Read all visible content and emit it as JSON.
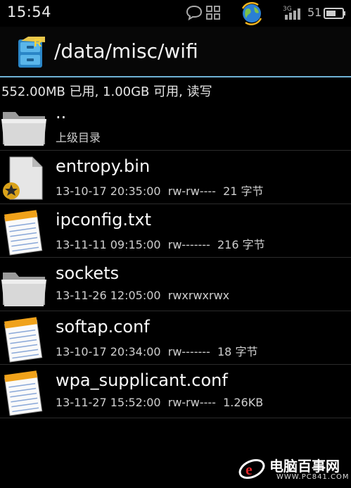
{
  "status_bar": {
    "time": "15:54",
    "icons": [
      "chat-bubble-icon",
      "grid-icon",
      "globe-sync-icon",
      "signal-3g-icon",
      "battery-icon"
    ],
    "network": "3G",
    "battery": "51"
  },
  "header": {
    "app_icon": "file-cabinet-icon",
    "path": "/data/misc/wifi"
  },
  "storage": {
    "text": "552.00MB 已用, 1.00GB 可用, 读写"
  },
  "files": [
    {
      "icon": "folder-icon",
      "name": "..",
      "meta": "上级目录"
    },
    {
      "icon": "binary-file-icon",
      "name": "entropy.bin",
      "meta": "13-10-17 20:35:00  rw-rw----  21 字节"
    },
    {
      "icon": "text-file-icon",
      "name": "ipconfig.txt",
      "meta": "13-11-11 09:15:00  rw-------  216 字节"
    },
    {
      "icon": "folder-icon",
      "name": "sockets",
      "meta": "13-11-26 12:05:00  rwxrwxrwx"
    },
    {
      "icon": "text-file-icon",
      "name": "softap.conf",
      "meta": "13-10-17 20:34:00  rw-------  18 字节"
    },
    {
      "icon": "text-file-icon",
      "name": "wpa_supplicant.conf",
      "meta": "13-11-27 15:52:00  rw-rw----  1.26KB"
    }
  ],
  "watermark": {
    "text": "电脑百事网",
    "url": "WWW.PC841.COM"
  },
  "colors": {
    "background": "#000000",
    "accent_line": "#6fb3d6",
    "folder": "#cfcfcf",
    "notepad_bar": "#f0a21a"
  }
}
